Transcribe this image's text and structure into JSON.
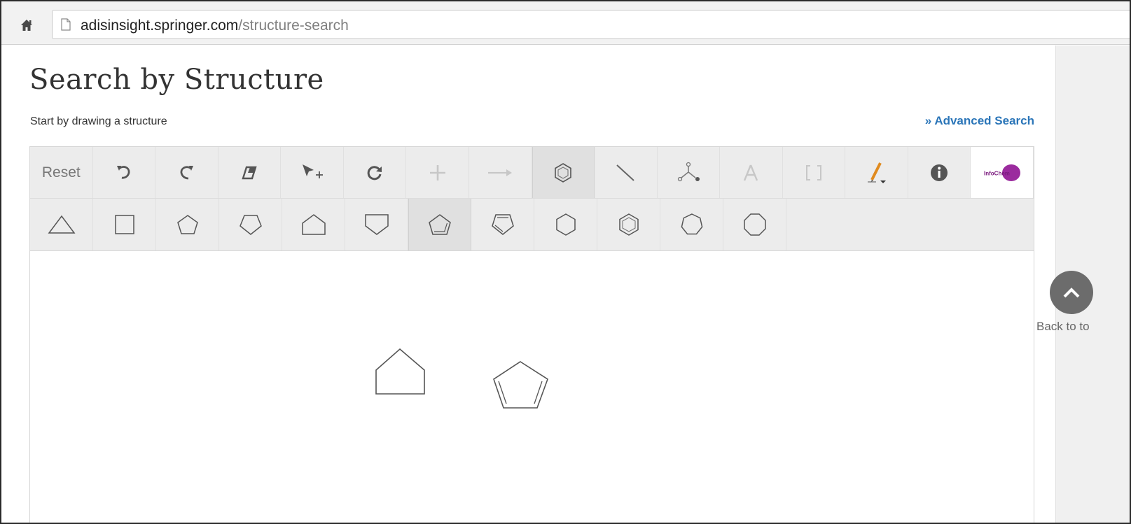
{
  "browser": {
    "url_host": "adisinsight.springer.com",
    "url_path": "/structure-search"
  },
  "page": {
    "title": "Search by Structure",
    "subtitle": "Start by drawing a structure",
    "advanced_search_label": "» Advanced Search",
    "back_to_top_label": "Back to to"
  },
  "toolbar": {
    "reset_label": "Reset",
    "tools": [
      "reset",
      "undo",
      "redo",
      "erase",
      "select",
      "rotate",
      "add-atom",
      "reaction-arrow",
      "ring",
      "bond",
      "chain",
      "atom-label",
      "bracket",
      "draw",
      "info",
      "infochem-logo"
    ],
    "logo_text": "InfoChem",
    "active_tool": "ring"
  },
  "ring_toolbar": {
    "templates": [
      "triangle",
      "square",
      "pentagon",
      "pentagon-inverted",
      "house",
      "pentagon-down",
      "cyclopentadiene",
      "cyclopentadiene-down",
      "hexagon",
      "benzene",
      "heptagon",
      "octagon"
    ],
    "active_template": "cyclopentadiene"
  },
  "canvas": {
    "structures": [
      "house-pentagon",
      "cyclopentadiene"
    ]
  },
  "colors": {
    "link": "#2a75b8",
    "logo": "#9b2b9e",
    "pencil": "#e08a1e"
  }
}
